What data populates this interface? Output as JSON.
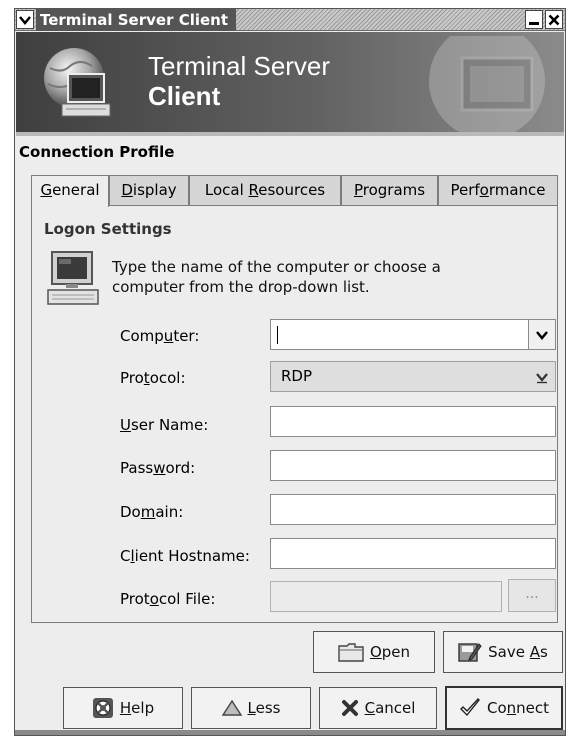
{
  "window": {
    "title": "Terminal Server Client"
  },
  "banner": {
    "line1": "Terminal Server",
    "line2": "Client"
  },
  "section_label": "Connection Profile",
  "tabs": [
    {
      "pre": "",
      "key": "G",
      "post": "eneral",
      "active": true
    },
    {
      "pre": "",
      "key": "D",
      "post": "isplay",
      "active": false
    },
    {
      "pre": "Local ",
      "key": "R",
      "post": "esources",
      "active": false
    },
    {
      "pre": "",
      "key": "P",
      "post": "rograms",
      "active": false
    },
    {
      "pre": "Perf",
      "key": "o",
      "post": "rmance",
      "active": false
    }
  ],
  "logon": {
    "heading": "Logon Settings",
    "hint": "Type the name of the computer or choose a computer from the drop-down list."
  },
  "fields": {
    "computer": {
      "pre": "Comp",
      "key": "u",
      "post": "ter:",
      "value": ""
    },
    "protocol": {
      "pre": "Pro",
      "key": "t",
      "post": "ocol:",
      "value": "RDP"
    },
    "username": {
      "pre": "",
      "key": "U",
      "post": "ser Name:",
      "value": ""
    },
    "password": {
      "pre": "Pass",
      "key": "w",
      "post": "ord:",
      "value": ""
    },
    "domain": {
      "pre": "Do",
      "key": "m",
      "post": "ain:",
      "value": ""
    },
    "client_hostname": {
      "pre": "C",
      "key": "l",
      "post": "ient Hostname:",
      "value": ""
    },
    "protocol_file": {
      "pre": "Prot",
      "key": "o",
      "post": "col File:",
      "value": ""
    },
    "browse_label": "..."
  },
  "buttons": {
    "open": {
      "pre": "",
      "key": "O",
      "post": "pen"
    },
    "save_as": {
      "pre": "Save ",
      "key": "A",
      "post": "s"
    },
    "help": {
      "pre": "",
      "key": "H",
      "post": "elp"
    },
    "less": {
      "pre": "",
      "key": "L",
      "post": "ess"
    },
    "cancel": {
      "pre": "",
      "key": "C",
      "post": "ancel"
    },
    "connect": {
      "pre": "Co",
      "key": "n",
      "post": "nect"
    }
  },
  "icons": {
    "window_menu": "chevron-down-icon",
    "minimize": "minimize-icon",
    "close": "close-icon",
    "banner_logo": "globe-computer-icon",
    "logon": "computer-icon",
    "open": "folder-icon",
    "save_as": "save-as-icon",
    "help": "help-lifebuoy-icon",
    "less": "triangle-up-icon",
    "cancel": "cancel-x-icon",
    "connect": "checkmark-icon"
  }
}
